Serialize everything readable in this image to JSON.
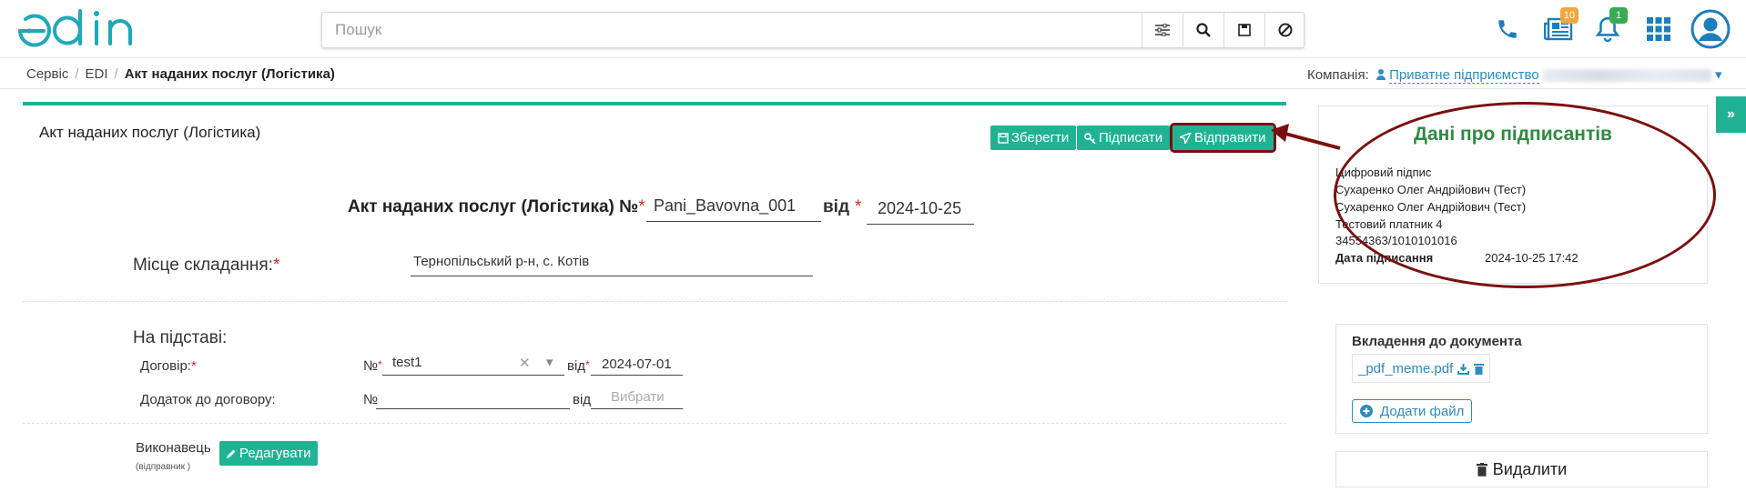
{
  "header": {
    "logo": "edin",
    "search_placeholder": "Пошук",
    "icons": [
      "filter-icon",
      "search-icon",
      "save-icon",
      "cancel-icon"
    ],
    "news_count": "10",
    "notifications_count": "1"
  },
  "breadcrumb": {
    "items": [
      "Сервіс",
      "EDI",
      "Акт наданих послуг (Логістика)"
    ]
  },
  "company": {
    "label": "Компанія:",
    "value": "Приватне підприємство"
  },
  "card": {
    "title": "Акт наданих послуг (Логістика)",
    "save_label": "Зберегти",
    "sign_label": "Підписати",
    "send_label": "Відправити"
  },
  "document": {
    "heading": "Акт наданих послуг (Логістика) №",
    "number": "Pani_Bavovna_001",
    "from_label": "від",
    "date": "2024-10-25",
    "place_label": "Місце складання:",
    "place_value": "Тернопільський р-н, с. Котів",
    "basis_label": "На підставі:",
    "contract_label": "Договір:",
    "no_label": "№",
    "contract_number": "test1",
    "contract_date": "2024-07-01",
    "addendum_label": "Додаток до договору:",
    "addendum_date_placeholder": "Вибрати",
    "performer_label": "Виконавець",
    "performer_sub": "(відправник )",
    "edit_label": "Редагувати"
  },
  "signers": {
    "title": "Дані про підписантів",
    "type": "Цифровий підпис",
    "line1": "Сухаренко Олег Андрійович (Тест)",
    "line2": "Сухаренко Олег Андрійович (Тест)",
    "line3": "Тестовий платник 4",
    "code": "34554363/1010101016",
    "sign_date_label": "Дата підписання",
    "sign_date": "2024-10-25 17:42"
  },
  "attachments": {
    "title": "Вкладення до документа",
    "file": "_pdf_meme.pdf",
    "add_label": "Додати файл"
  },
  "delete_label": "Видалити",
  "colors": {
    "accent": "#1fb394",
    "annotation": "#7a0f0f",
    "link": "#2e8bc0",
    "signer_title": "#2e8b3f"
  }
}
